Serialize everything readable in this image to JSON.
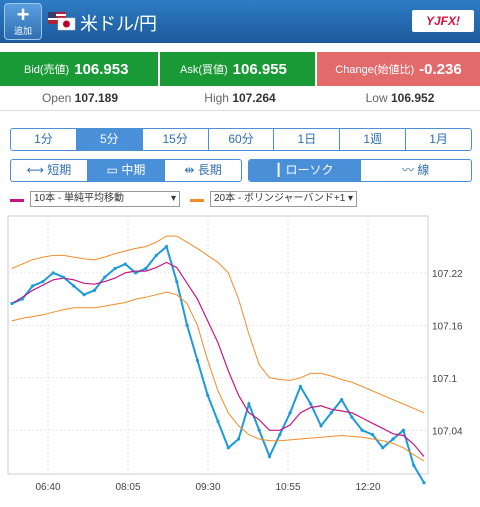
{
  "header": {
    "add_icon": "plus-icon",
    "add_label": "追加",
    "flag_icon": "us-jp-flag-icon",
    "pair": "米ドル/円",
    "logo": "YJFX!"
  },
  "quote": {
    "bid_label": "Bid(売値)",
    "bid_value": "106.953",
    "ask_label": "Ask(買値)",
    "ask_value": "106.955",
    "change_label": "Change(始値比)",
    "change_value": "-0.236"
  },
  "stats": {
    "open_label": "Open",
    "open_value": "107.189",
    "high_label": "High",
    "high_value": "107.264",
    "low_label": "Low",
    "low_value": "106.952"
  },
  "timeframes": [
    "1分",
    "5分",
    "15分",
    "60分",
    "1日",
    "1週",
    "1月"
  ],
  "timeframe_selected": "5分",
  "period": [
    {
      "label": "短期",
      "icon": "compress-icon"
    },
    {
      "label": "中期",
      "icon": "medium-icon"
    },
    {
      "label": "長期",
      "icon": "expand-icon"
    }
  ],
  "chart_style": [
    {
      "label": "ローソク",
      "icon": "candlestick-icon"
    },
    {
      "label": "線",
      "icon": "line-chart-icon"
    }
  ],
  "indicator1": "10本 - 単純平均移動",
  "indicator2": "20本 - ボリンジャーバンド+1",
  "colors": {
    "ma": "#c71585",
    "bollinger": "#f28c28",
    "candle": "#1e9bd7",
    "header": "#2e7cc4",
    "green": "#1a9a36",
    "red": "#e36a6a"
  },
  "chart_data": {
    "type": "line",
    "x_ticks": [
      "06:40",
      "08:05",
      "09:30",
      "10:55",
      "12:20"
    ],
    "y_ticks": [
      "107.22",
      "107.16",
      "107.1",
      "107.04"
    ],
    "ylim": [
      106.99,
      107.285
    ],
    "series": [
      {
        "values": [
          107.185,
          107.19,
          107.205,
          107.21,
          107.22,
          107.215,
          107.205,
          107.195,
          107.2,
          107.215,
          107.225,
          107.23,
          107.22,
          107.225,
          107.24,
          107.25,
          107.21,
          107.16,
          107.12,
          107.08,
          107.05,
          107.02,
          107.03,
          107.07,
          107.04,
          107.01,
          107.035,
          107.06,
          107.09,
          107.07,
          107.045,
          107.06,
          107.075,
          107.055,
          107.04,
          107.035,
          107.02,
          107.03,
          107.04,
          107.0,
          106.98
        ]
      },
      {
        "values": [
          107.185,
          107.192,
          107.2,
          107.206,
          107.212,
          107.214,
          107.212,
          107.208,
          107.207,
          107.21,
          107.214,
          107.22,
          107.222,
          107.222,
          107.226,
          107.232,
          107.226,
          107.208,
          107.19,
          107.165,
          107.14,
          107.108,
          107.08,
          107.06,
          107.052,
          107.04,
          107.04,
          107.046,
          107.06,
          107.066,
          107.068,
          107.064,
          107.062,
          107.06,
          107.054,
          107.048,
          107.042,
          107.036,
          107.034,
          107.024,
          107.01
        ]
      },
      {
        "values": [
          107.225,
          107.23,
          107.235,
          107.238,
          107.24,
          107.24,
          107.238,
          107.236,
          107.235,
          107.238,
          107.242,
          107.245,
          107.248,
          107.25,
          107.255,
          107.262,
          107.262,
          107.255,
          107.248,
          107.24,
          107.232,
          107.22,
          107.19,
          107.15,
          107.115,
          107.1,
          107.098,
          107.097,
          107.1,
          107.105,
          107.105,
          107.102,
          107.098,
          107.095,
          107.09,
          107.085,
          107.08,
          107.075,
          107.07,
          107.065,
          107.06
        ]
      },
      {
        "values": [
          107.165,
          107.168,
          107.17,
          107.172,
          107.175,
          107.178,
          107.18,
          107.18,
          107.18,
          107.182,
          107.184,
          107.186,
          107.19,
          107.192,
          107.195,
          107.198,
          107.195,
          107.185,
          107.16,
          107.12,
          107.085,
          107.06,
          107.045,
          107.035,
          107.03,
          107.028,
          107.028,
          107.029,
          107.03,
          107.031,
          107.032,
          107.033,
          107.034,
          107.033,
          107.032,
          107.03,
          107.028,
          107.025,
          107.02,
          107.012,
          107.005
        ]
      }
    ]
  }
}
